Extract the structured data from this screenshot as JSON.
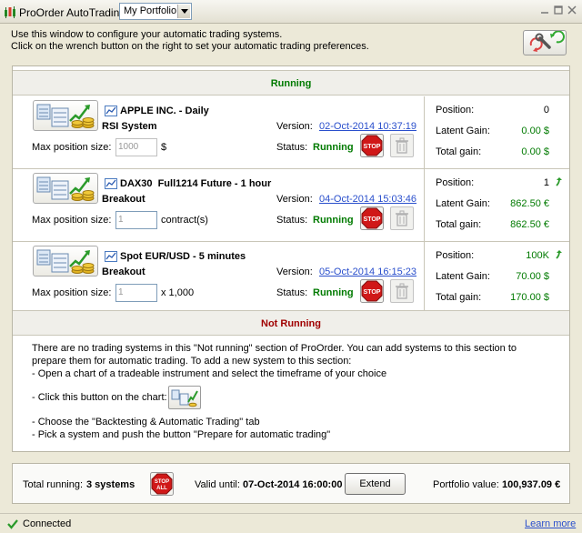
{
  "window": {
    "title": "ProOrder AutoTrading",
    "portfolio_selected": "My Portfolio",
    "minimize_icon": "minimize-icon",
    "maximize_icon": "maximize-icon",
    "close_icon": "close-icon"
  },
  "intro": {
    "line1": "Use this window to configure your automatic trading systems.",
    "line2": "Click on the wrench button on the right to set your automatic trading preferences."
  },
  "running_header": "Running",
  "systems": [
    {
      "name": "APPLE INC. - Daily",
      "strategy": "RSI System",
      "max_position_label": "Max position size:",
      "max_position_value": "1000",
      "max_position_unit": "$",
      "version_label": "Version:",
      "version": "02-Oct-2014 10:37:19",
      "status_label": "Status:",
      "status": "Running",
      "position_label": "Position:",
      "position": "0",
      "latent_gain_label": "Latent Gain:",
      "latent_gain": "0.00 $",
      "total_gain_label": "Total gain:",
      "total_gain": "0.00 $"
    },
    {
      "name": "DAX30  Full1214 Future - 1 hour",
      "strategy": "Breakout",
      "max_position_label": "Max position size:",
      "max_position_value": "1",
      "max_position_unit": "contract(s)",
      "version_label": "Version:",
      "version": "04-Oct-2014 15:03:46",
      "status_label": "Status:",
      "status": "Running",
      "position_label": "Position:",
      "position": "1",
      "latent_gain_label": "Latent Gain:",
      "latent_gain": "862.50 €",
      "total_gain_label": "Total gain:",
      "total_gain": "862.50 €"
    },
    {
      "name": "Spot EUR/USD - 5 minutes",
      "strategy": "Breakout",
      "max_position_label": "Max position size:",
      "max_position_value": "1",
      "max_position_unit": "x 1,000",
      "version_label": "Version:",
      "version": "05-Oct-2014 16:15:23",
      "status_label": "Status:",
      "status": "Running",
      "position_label": "Position:",
      "position": "100K",
      "latent_gain_label": "Latent Gain:",
      "latent_gain": "70.00 $",
      "total_gain_label": "Total gain:",
      "total_gain": "170.00 $"
    }
  ],
  "stop_label": "STOP",
  "not_running": {
    "header": "Not Running",
    "line1": "There are no trading systems in this \"Not running\" section of ProOrder. You can add systems to this section to",
    "line2": "prepare them for automatic trading. To add a new system to this section:",
    "line3": "- Open a chart of a tradeable instrument and select the timeframe of your choice",
    "line4": "- Click this button on the chart:",
    "line5": "- Choose the \"Backtesting & Automatic Trading\" tab",
    "line6": "- Pick a system and push the button \"Prepare for automatic trading\""
  },
  "footer": {
    "total_running_label": "Total running:",
    "total_running_value": "3 systems",
    "stop_all_label_1": "STOP",
    "stop_all_label_2": "ALL",
    "valid_until_label": "Valid until:",
    "valid_until_value": "07-Oct-2014 16:00:00",
    "extend_label": "Extend",
    "portfolio_value_label": "Portfolio value:",
    "portfolio_value": "100,937.09 €"
  },
  "statusbar": {
    "connected": "Connected",
    "learn_more": "Learn more"
  },
  "colors": {
    "running_green": "#007a00",
    "not_running_red": "#a00000",
    "link_blue": "#2a4fcc",
    "stop_red": "#d01818"
  }
}
